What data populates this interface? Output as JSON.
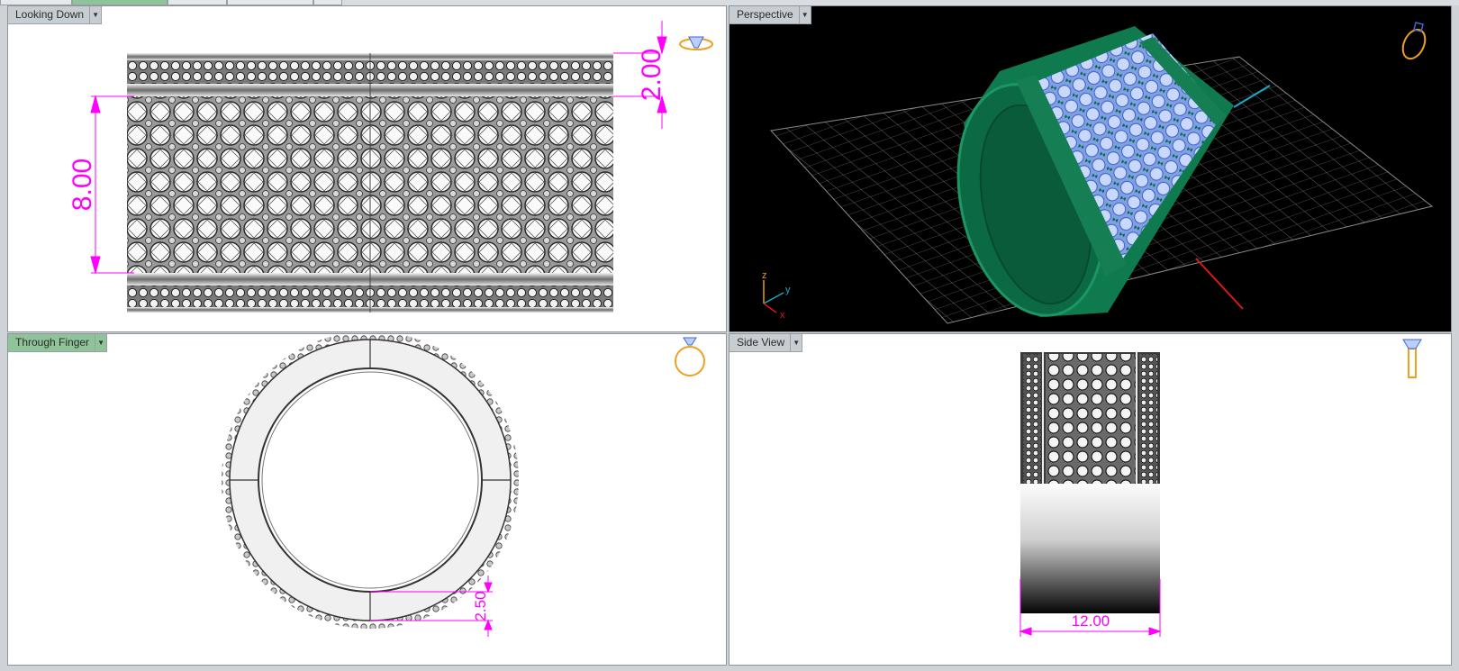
{
  "viewports": {
    "top_left": {
      "label": "Looking Down"
    },
    "top_right": {
      "label": "Perspective"
    },
    "bottom_left": {
      "label": "Through Finger"
    },
    "bottom_right": {
      "label": "Side View"
    }
  },
  "dimensions": {
    "height_top": "2.00",
    "width_center": "8.00",
    "band_thickness": "2.50",
    "band_width": "12.00"
  },
  "axes": {
    "z": "z",
    "y": "y",
    "x": "x"
  },
  "colors": {
    "dimension": "#ff00ff",
    "metal_green": "#0f7a4e",
    "gem_blue": "#a9c4ff",
    "view_cube_orange": "#f0a020",
    "active_label": "#8fc49a"
  },
  "icons": [
    "dropdown-arrow-icon",
    "view-orientation-icon",
    "diamond-icon",
    "ring-icon"
  ]
}
